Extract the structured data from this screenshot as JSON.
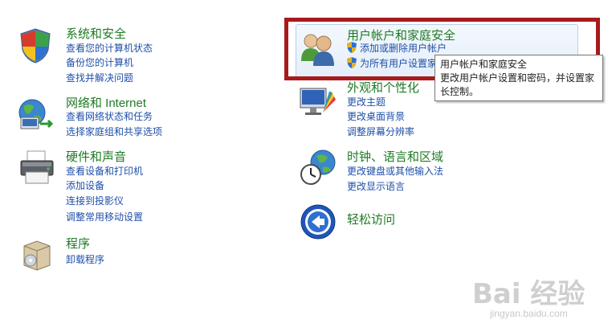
{
  "categories": {
    "system_security": {
      "title": "系统和安全",
      "links": [
        "查看您的计算机状态",
        "备份您的计算机",
        "查找并解决问题"
      ],
      "icon": "shield-icon"
    },
    "network": {
      "title": "网络和 Internet",
      "links": [
        "查看网络状态和任务",
        "选择家庭组和共享选项"
      ],
      "icon": "network-globe-icon"
    },
    "hardware_sound": {
      "title": "硬件和声音",
      "links": [
        "查看设备和打印机",
        "添加设备",
        "连接到投影仪",
        "调整常用移动设置"
      ],
      "icon": "printer-icon"
    },
    "programs": {
      "title": "程序",
      "links": [
        "卸载程序"
      ],
      "icon": "programs-box-icon"
    },
    "user_accounts": {
      "title": "用户帐户和家庭安全",
      "links": [
        "添加或删除用户帐户",
        "为所有用户设置家"
      ],
      "icon": "users-icon"
    },
    "appearance": {
      "title": "外观和个性化",
      "links": [
        "更改主题",
        "更改桌面背景",
        "调整屏幕分辨率"
      ],
      "icon": "appearance-monitor-icon"
    },
    "clock_region": {
      "title": "时钟、语言和区域",
      "links": [
        "更改键盘或其他输入法",
        "更改显示语言"
      ],
      "icon": "clock-globe-icon"
    },
    "ease_of_access": {
      "title": "轻松访问",
      "links": [],
      "icon": "ease-of-access-icon"
    }
  },
  "tooltip": {
    "title": "用户帐户和家庭安全",
    "line1": "更改用户帐户设置和密码，并设置家",
    "line2": "长控制。"
  },
  "watermark": {
    "logo": "Bai 经验",
    "sub": "jingyan.baidu.com"
  },
  "colors": {
    "title_green": "#1e7a24",
    "link_blue": "#1f4fa8",
    "highlight_red": "#a81a1c"
  }
}
